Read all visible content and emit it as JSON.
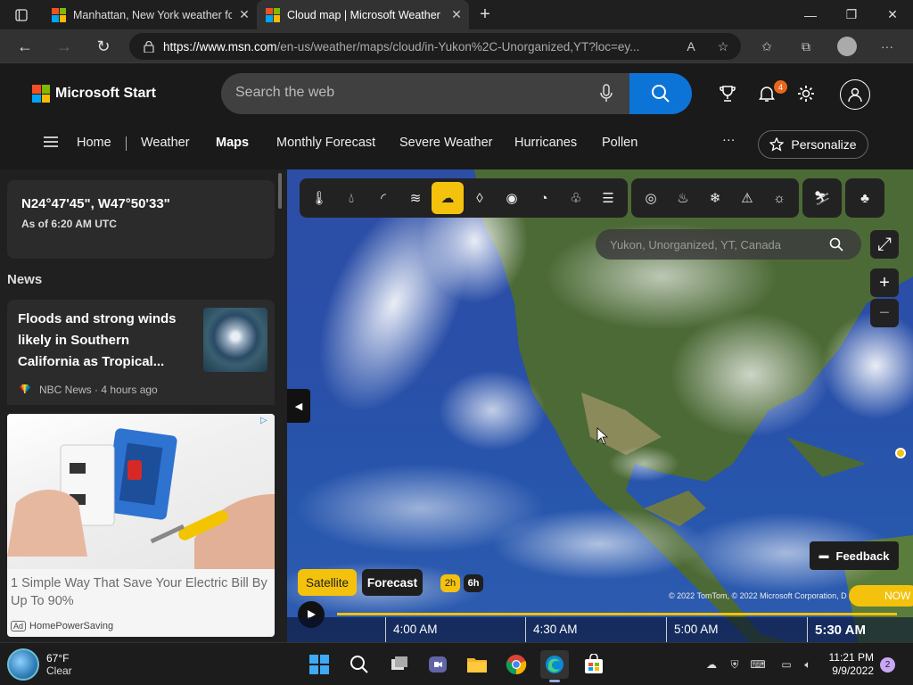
{
  "browser": {
    "tabs": [
      {
        "title": "Manhattan, New York weather fo",
        "active": false
      },
      {
        "title": "Cloud map | Microsoft Weather",
        "active": true
      }
    ],
    "new_tab": "+",
    "url_domain": "https://www.msn.com",
    "url_path": "/en-us/weather/maps/cloud/in-Yukon%2C-Unorganized,YT?loc=ey..."
  },
  "msn": {
    "logo_text": "Microsoft Start",
    "search_placeholder": "Search the web",
    "notification_count": "4",
    "nav": [
      "Home",
      "Weather",
      "Maps",
      "Monthly Forecast",
      "Severe Weather",
      "Hurricanes",
      "Pollen"
    ],
    "nav_more": "···",
    "personalize": "Personalize"
  },
  "left_pane": {
    "coords": "N24°47'45\", W47°50'33\"",
    "as_of": "As of 6:20 AM UTC",
    "news_heading": "News",
    "news_item": {
      "headline": "Floods and strong winds likely in Southern California as Tropical...",
      "source": "NBC News · 4 hours ago"
    },
    "ad": {
      "text": "1 Simple Way That Save Your Electric Bill By Up To 90%",
      "badge": "Ad",
      "advertiser": "HomePowerSaving"
    }
  },
  "map": {
    "search_placeholder": "Yukon, Unorganized, YT, Canada",
    "toolbar": [
      "thermometer-icon",
      "precipitation-icon",
      "radar-icon",
      "wind-icon",
      "cloud-icon",
      "humidity-icon",
      "visibility-icon",
      "pressure-icon",
      "pollen-icon",
      "fog-icon",
      "hurricane-icon",
      "fire-icon",
      "snow-icon",
      "warning-icon",
      "sun-icon",
      "ski-icon",
      "tree-icon"
    ],
    "selected_tool": "cloud-icon",
    "feedback": "Feedback",
    "modes": {
      "satellite": "Satellite",
      "forecast": "Forecast"
    },
    "intervals": {
      "h2": "2h",
      "h6": "6h"
    },
    "copyright": "© 2022 TomTom, © 2022 Microsoft Corporation, D",
    "now_label": "NOW",
    "times": [
      "4:00 AM",
      "4:30 AM",
      "5:00 AM",
      "5:30 AM"
    ]
  },
  "taskbar": {
    "temp": "67°F",
    "condition": "Clear",
    "time": "11:21 PM",
    "date": "9/9/2022",
    "notifications": "2"
  },
  "colors": {
    "accent_yellow": "#f4c20d",
    "search_blue": "#0c74d6",
    "badge_orange": "#e8661e"
  }
}
